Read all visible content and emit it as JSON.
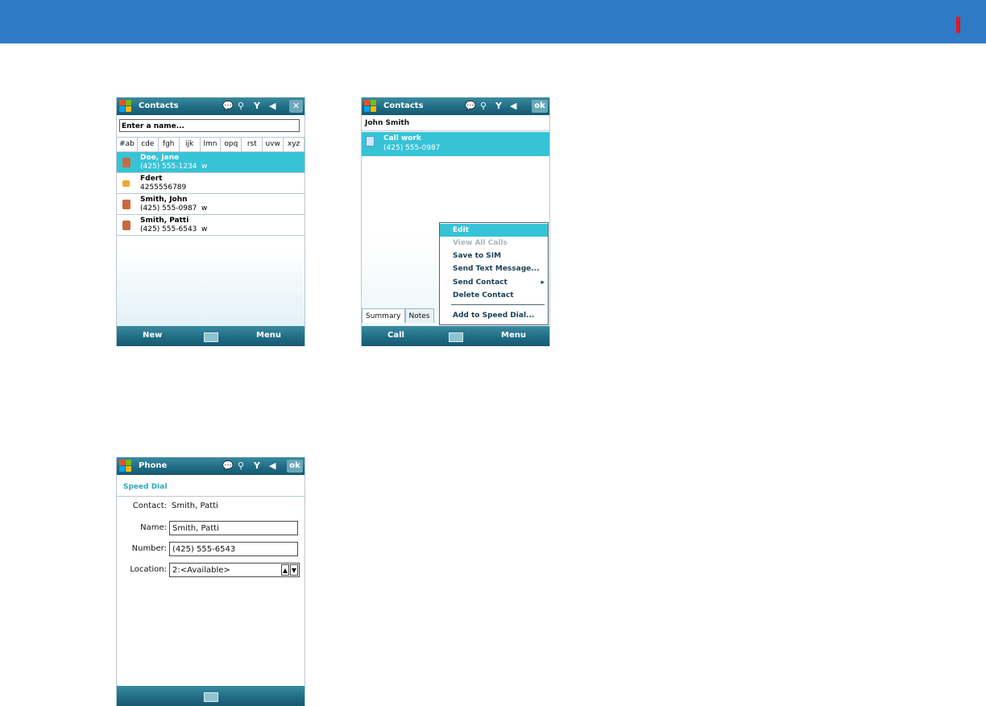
{
  "phone1": {
    "title": "Contacts",
    "status_icons": [
      "speech-bubble-icon",
      "connectivity-icon",
      "signal-icon",
      "volume-icon"
    ],
    "close_label": "✕",
    "search_placeholder": "Enter a name...",
    "alpha_tabs": [
      "#ab",
      "cde",
      "fgh",
      "ijk",
      "lmn",
      "opq",
      "rst",
      "uvw",
      "xyz"
    ],
    "contacts": [
      {
        "name": "Doe, Jane",
        "phone": "(425) 555-1234",
        "type": "w",
        "selected": true
      },
      {
        "name": "Fdert",
        "phone": "4255556789",
        "type": "",
        "selected": false
      },
      {
        "name": "Smith, John",
        "phone": "(425) 555-0987",
        "type": "w",
        "selected": false
      },
      {
        "name": "Smith, Patti",
        "phone": "(425) 555-6543",
        "type": "w",
        "selected": false
      }
    ],
    "softkey_left": "New",
    "softkey_right": "Menu"
  },
  "phone2": {
    "title": "Contacts",
    "ok_label": "ok",
    "contact_name": "John Smith",
    "call_label": "Call work",
    "call_number": "(425) 555-0987",
    "tabs": [
      "Summary",
      "Notes"
    ],
    "menu_items": [
      {
        "label": "Edit",
        "state": "selected"
      },
      {
        "label": "View All Calls",
        "state": "disabled"
      },
      {
        "label": "Save to SIM",
        "state": "normal"
      },
      {
        "label": "Send Text Message...",
        "state": "normal"
      },
      {
        "label": "Send Contact",
        "state": "normal",
        "submenu": true
      },
      {
        "label": "Delete Contact",
        "state": "normal"
      },
      {
        "label": "Add to Speed Dial...",
        "state": "normal"
      }
    ],
    "submenu_arrow": "▸",
    "softkey_left": "Call",
    "softkey_right": "Menu"
  },
  "phone3": {
    "title": "Phone",
    "ok_label": "ok",
    "section_title": "Speed Dial",
    "contact_label": "Contact:",
    "contact_value": "Smith, Patti",
    "name_label": "Name:",
    "name_value": "Smith, Patti",
    "number_label": "Number:",
    "number_value": "(425) 555-6543",
    "location_label": "Location:",
    "location_value": "2:<Available>",
    "spin_up": "▲",
    "spin_down": "▼"
  },
  "colors": {
    "top_bar": "#2f7ac6",
    "accent_red": "#e8141c",
    "selection": "#37c3d6",
    "title_bar": "#1f6a82"
  }
}
